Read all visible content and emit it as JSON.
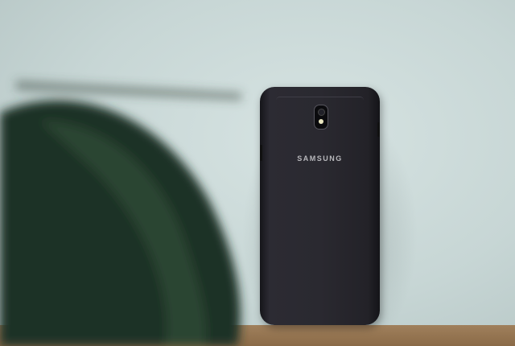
{
  "phone": {
    "brand_logo": "SAMSUNG"
  },
  "colors": {
    "wall": "#c9d8d8",
    "phone": "#2a2930",
    "shelf": "#9a7a55",
    "leaf": "#1f3326"
  }
}
